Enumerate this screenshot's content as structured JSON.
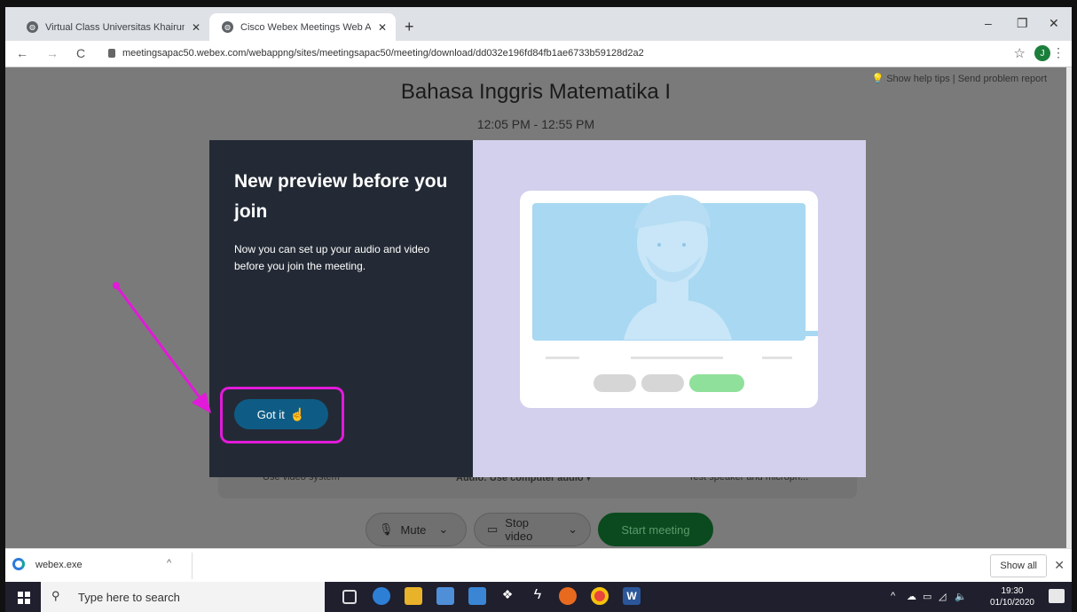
{
  "browser": {
    "tabs": [
      {
        "label": "Virtual Class Universitas Khairun"
      },
      {
        "label": "Cisco Webex Meetings Web App"
      }
    ],
    "tab_close": "✕",
    "new_tab": "+",
    "window_controls": {
      "minimize": "–",
      "restore": "❐",
      "close": "✕"
    },
    "nav": {
      "back": "←",
      "forward": "→",
      "reload": "C"
    },
    "url": "meetingsapac50.webex.com/webappng/sites/meetingsapac50/meeting/download/dd032e196fd84fb1ae6733b59128d2a2",
    "bookmark": "☆",
    "profile_initial": "J",
    "menu": "⋮"
  },
  "page": {
    "help_links": "Show help tips  |  Send problem report",
    "meeting_title": "Bahasa Inggris Matematika I",
    "meeting_time": "12:05 PM - 12:55 PM",
    "options": {
      "video_system": "Use video system",
      "audio": "Audio: Use computer audio ▾",
      "test": "Test speaker and microph..."
    },
    "controls": {
      "mute": "Mute",
      "stop_video": "Stop video",
      "start_meeting": "Start meeting"
    }
  },
  "modal": {
    "heading": "New preview before you join",
    "body": "Now you can set up your audio and video before you join the meeting.",
    "button": "Got it"
  },
  "colors": {
    "annotation": "#e21ad9",
    "modal_dark": "#232a35",
    "modal_light": "#d2d0ec",
    "button": "#0e5c85"
  },
  "downloads": {
    "file": "webex.exe",
    "chevron": "^",
    "show_all": "Show all",
    "close": "✕"
  },
  "taskbar": {
    "search_placeholder": "Type here to search",
    "time": "19:30",
    "date": "01/10/2020"
  }
}
